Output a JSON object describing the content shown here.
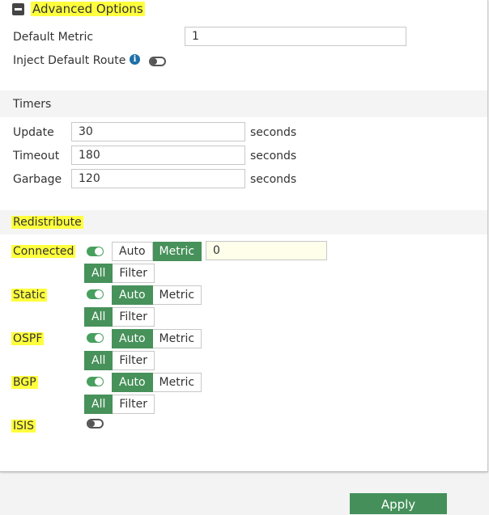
{
  "advanced": {
    "title": "Advanced Options"
  },
  "default_metric": {
    "label": "Default Metric",
    "value": "1"
  },
  "inject_default_route": {
    "label": "Inject Default Route",
    "info_icon": "info-icon",
    "enabled": false
  },
  "timers": {
    "title": "Timers",
    "rows": [
      {
        "label": "Update",
        "value": "30",
        "unit": "seconds"
      },
      {
        "label": "Timeout",
        "value": "180",
        "unit": "seconds"
      },
      {
        "label": "Garbage",
        "value": "120",
        "unit": "seconds"
      }
    ]
  },
  "redistribute": {
    "title": "Redistribute",
    "mode_options": [
      "Auto",
      "Metric"
    ],
    "filter_options": [
      "All",
      "Filter"
    ],
    "items": [
      {
        "label": "Connected",
        "enabled": true,
        "mode": "Metric",
        "metric_value": "0",
        "filter": "All"
      },
      {
        "label": "Static",
        "enabled": true,
        "mode": "Auto",
        "filter": "All"
      },
      {
        "label": "OSPF",
        "enabled": true,
        "mode": "Auto",
        "filter": "All"
      },
      {
        "label": "BGP",
        "enabled": true,
        "mode": "Auto",
        "filter": "All"
      },
      {
        "label": "ISIS",
        "enabled": false
      }
    ]
  },
  "footer": {
    "apply_label": "Apply"
  },
  "colors": {
    "accent": "#47915a",
    "highlight": "#ffff3d",
    "info": "#1e6fa8"
  }
}
